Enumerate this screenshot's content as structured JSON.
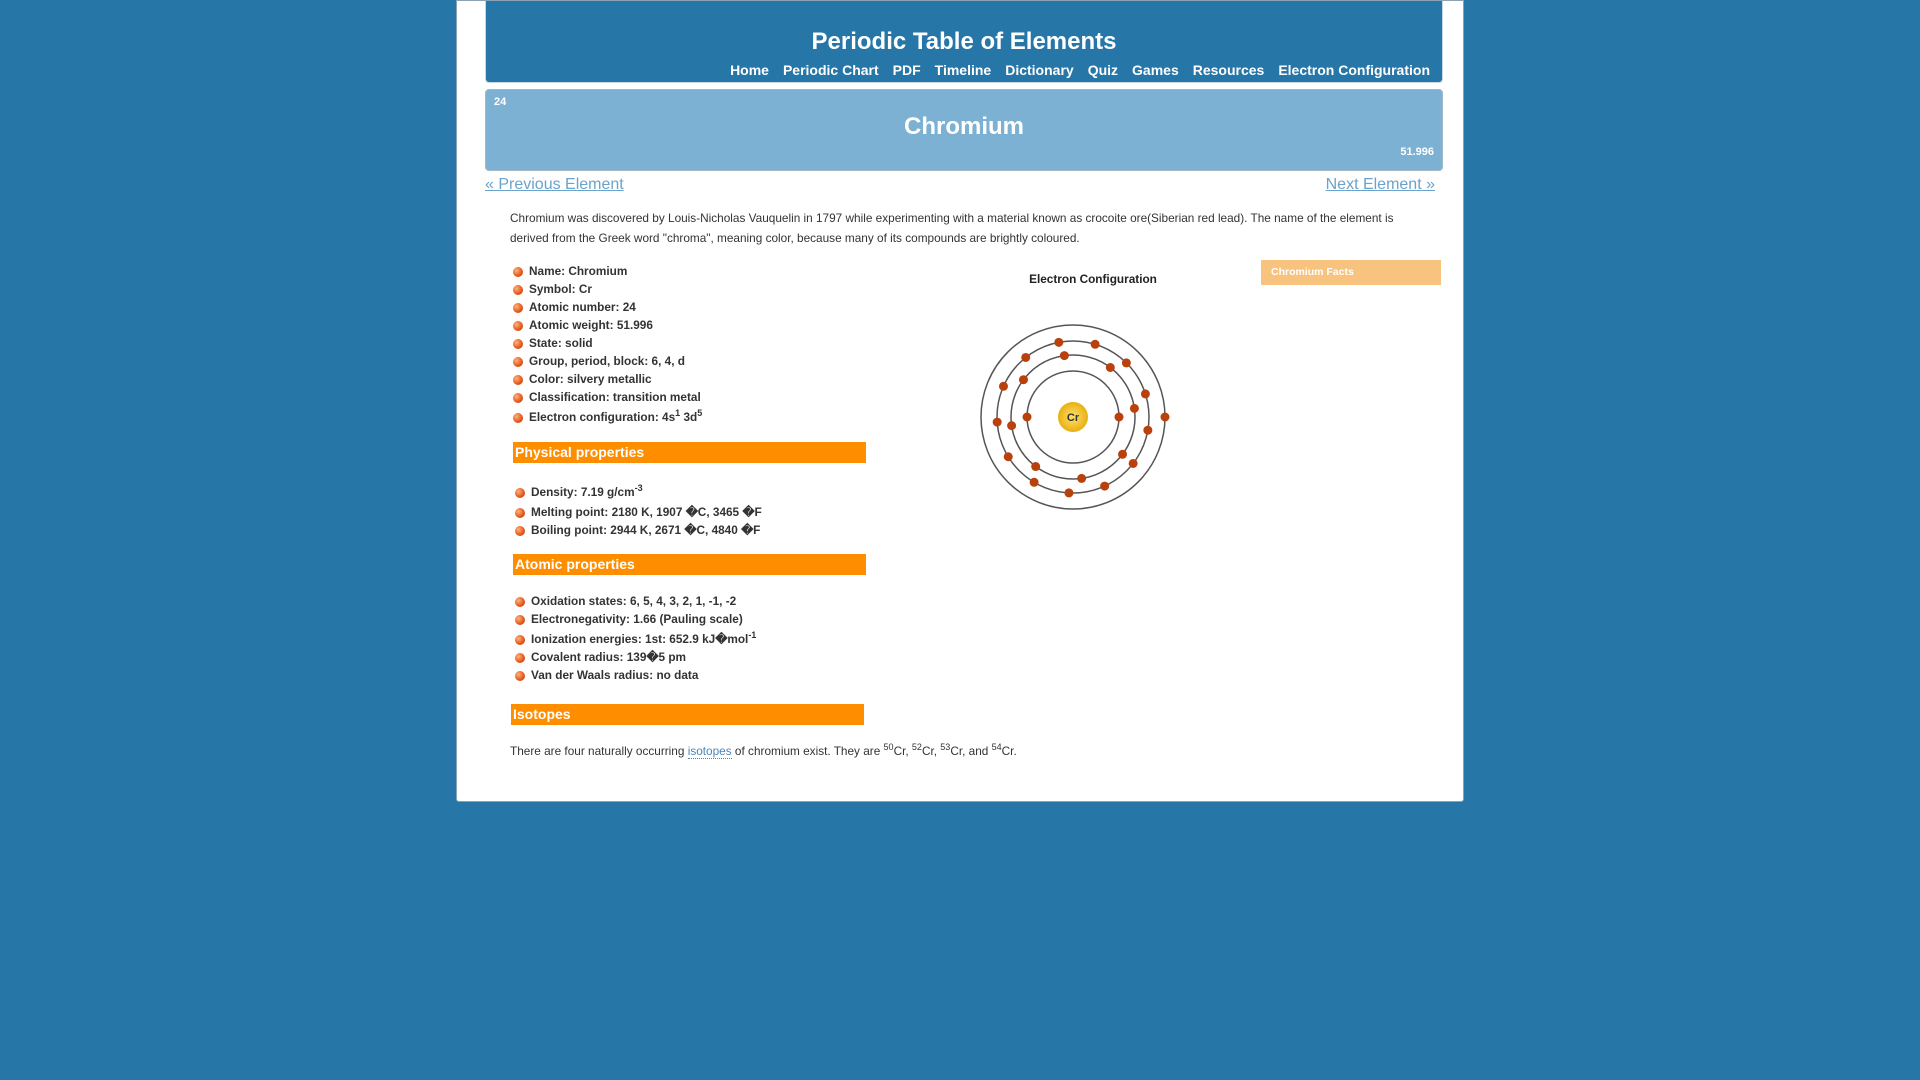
{
  "site": {
    "title": "Periodic Table of Elements",
    "nav": [
      "Home",
      "Periodic Chart",
      "PDF",
      "Timeline",
      "Dictionary",
      "Quiz",
      "Games",
      "Resources",
      "Electron Configuration"
    ]
  },
  "element": {
    "number": "24",
    "name": "Chromium",
    "weight": "51.996",
    "symbol": "Cr"
  },
  "pager": {
    "prev": "« Previous Element",
    "next": "Next Element »"
  },
  "intro": "Chromium was discovered by Louis-Nicholas Vauquelin in 1797 while experimenting with a material known as crocoite ore(Siberian red lead). The name of the element is derived from the Greek word \"chroma\", meaning color, because many of its compounds are brightly coloured.",
  "basic_properties": [
    {
      "label": "Name: Chromium"
    },
    {
      "label": "Symbol: Cr"
    },
    {
      "label": "Atomic number: 24"
    },
    {
      "label": "Atomic weight: 51.996"
    },
    {
      "label": "State: solid"
    },
    {
      "label": "Group, period, block: 6, 4, d"
    },
    {
      "label": "Color: silvery metallic"
    },
    {
      "label": "Classification: transition metal"
    },
    {
      "label": "Electron configuration: 4s",
      "sup": "1",
      "after": " 3d",
      "sup2": "5"
    }
  ],
  "sections": {
    "physical": "Physical properties",
    "atomic": "Atomic properties",
    "isotopes": "Isotopes"
  },
  "physical_properties": [
    {
      "label": "Density: 7.19 g/cm",
      "sup": "-3"
    },
    {
      "label": "Melting point: 2180 K, 1907 �C, 3465 �F"
    },
    {
      "label": "Boiling point: 2944 K, 2671 �C, 4840 �F"
    }
  ],
  "atomic_properties": [
    {
      "label": "Oxidation states: 6, 5, 4, 3, 2, 1, -1, -2"
    },
    {
      "label": "Electronegativity: 1.66 (Pauling scale)"
    },
    {
      "label": "Ionization energies: 1st: 652.9 kJ�mol",
      "sup": "-1"
    },
    {
      "label": "Covalent radius: 139�5 pm"
    },
    {
      "label": "Van der Waals radius: no data"
    }
  ],
  "electron_config_label": "Electron Configuration",
  "shell_electrons": [
    2,
    8,
    13,
    1
  ],
  "colors": {
    "background": "#2676a8",
    "banner": "#7db1d3",
    "section_bar": "#ff8d00",
    "facts_box": "#f8c27f",
    "electron": "#b8410c",
    "nucleus": "#e8b010"
  },
  "facts_box": "Chromium Facts",
  "isotopes": {
    "before": "There are four naturally occurring ",
    "link": "isotopes",
    "after": " of chromium exist. They are ",
    "list": [
      {
        "mass": "50",
        "symbol": "Cr",
        "sep": ", "
      },
      {
        "mass": "52",
        "symbol": "Cr",
        "sep": ", "
      },
      {
        "mass": "53",
        "symbol": "Cr",
        "sep": ", and "
      },
      {
        "mass": "54",
        "symbol": "Cr",
        "sep": "."
      }
    ]
  }
}
